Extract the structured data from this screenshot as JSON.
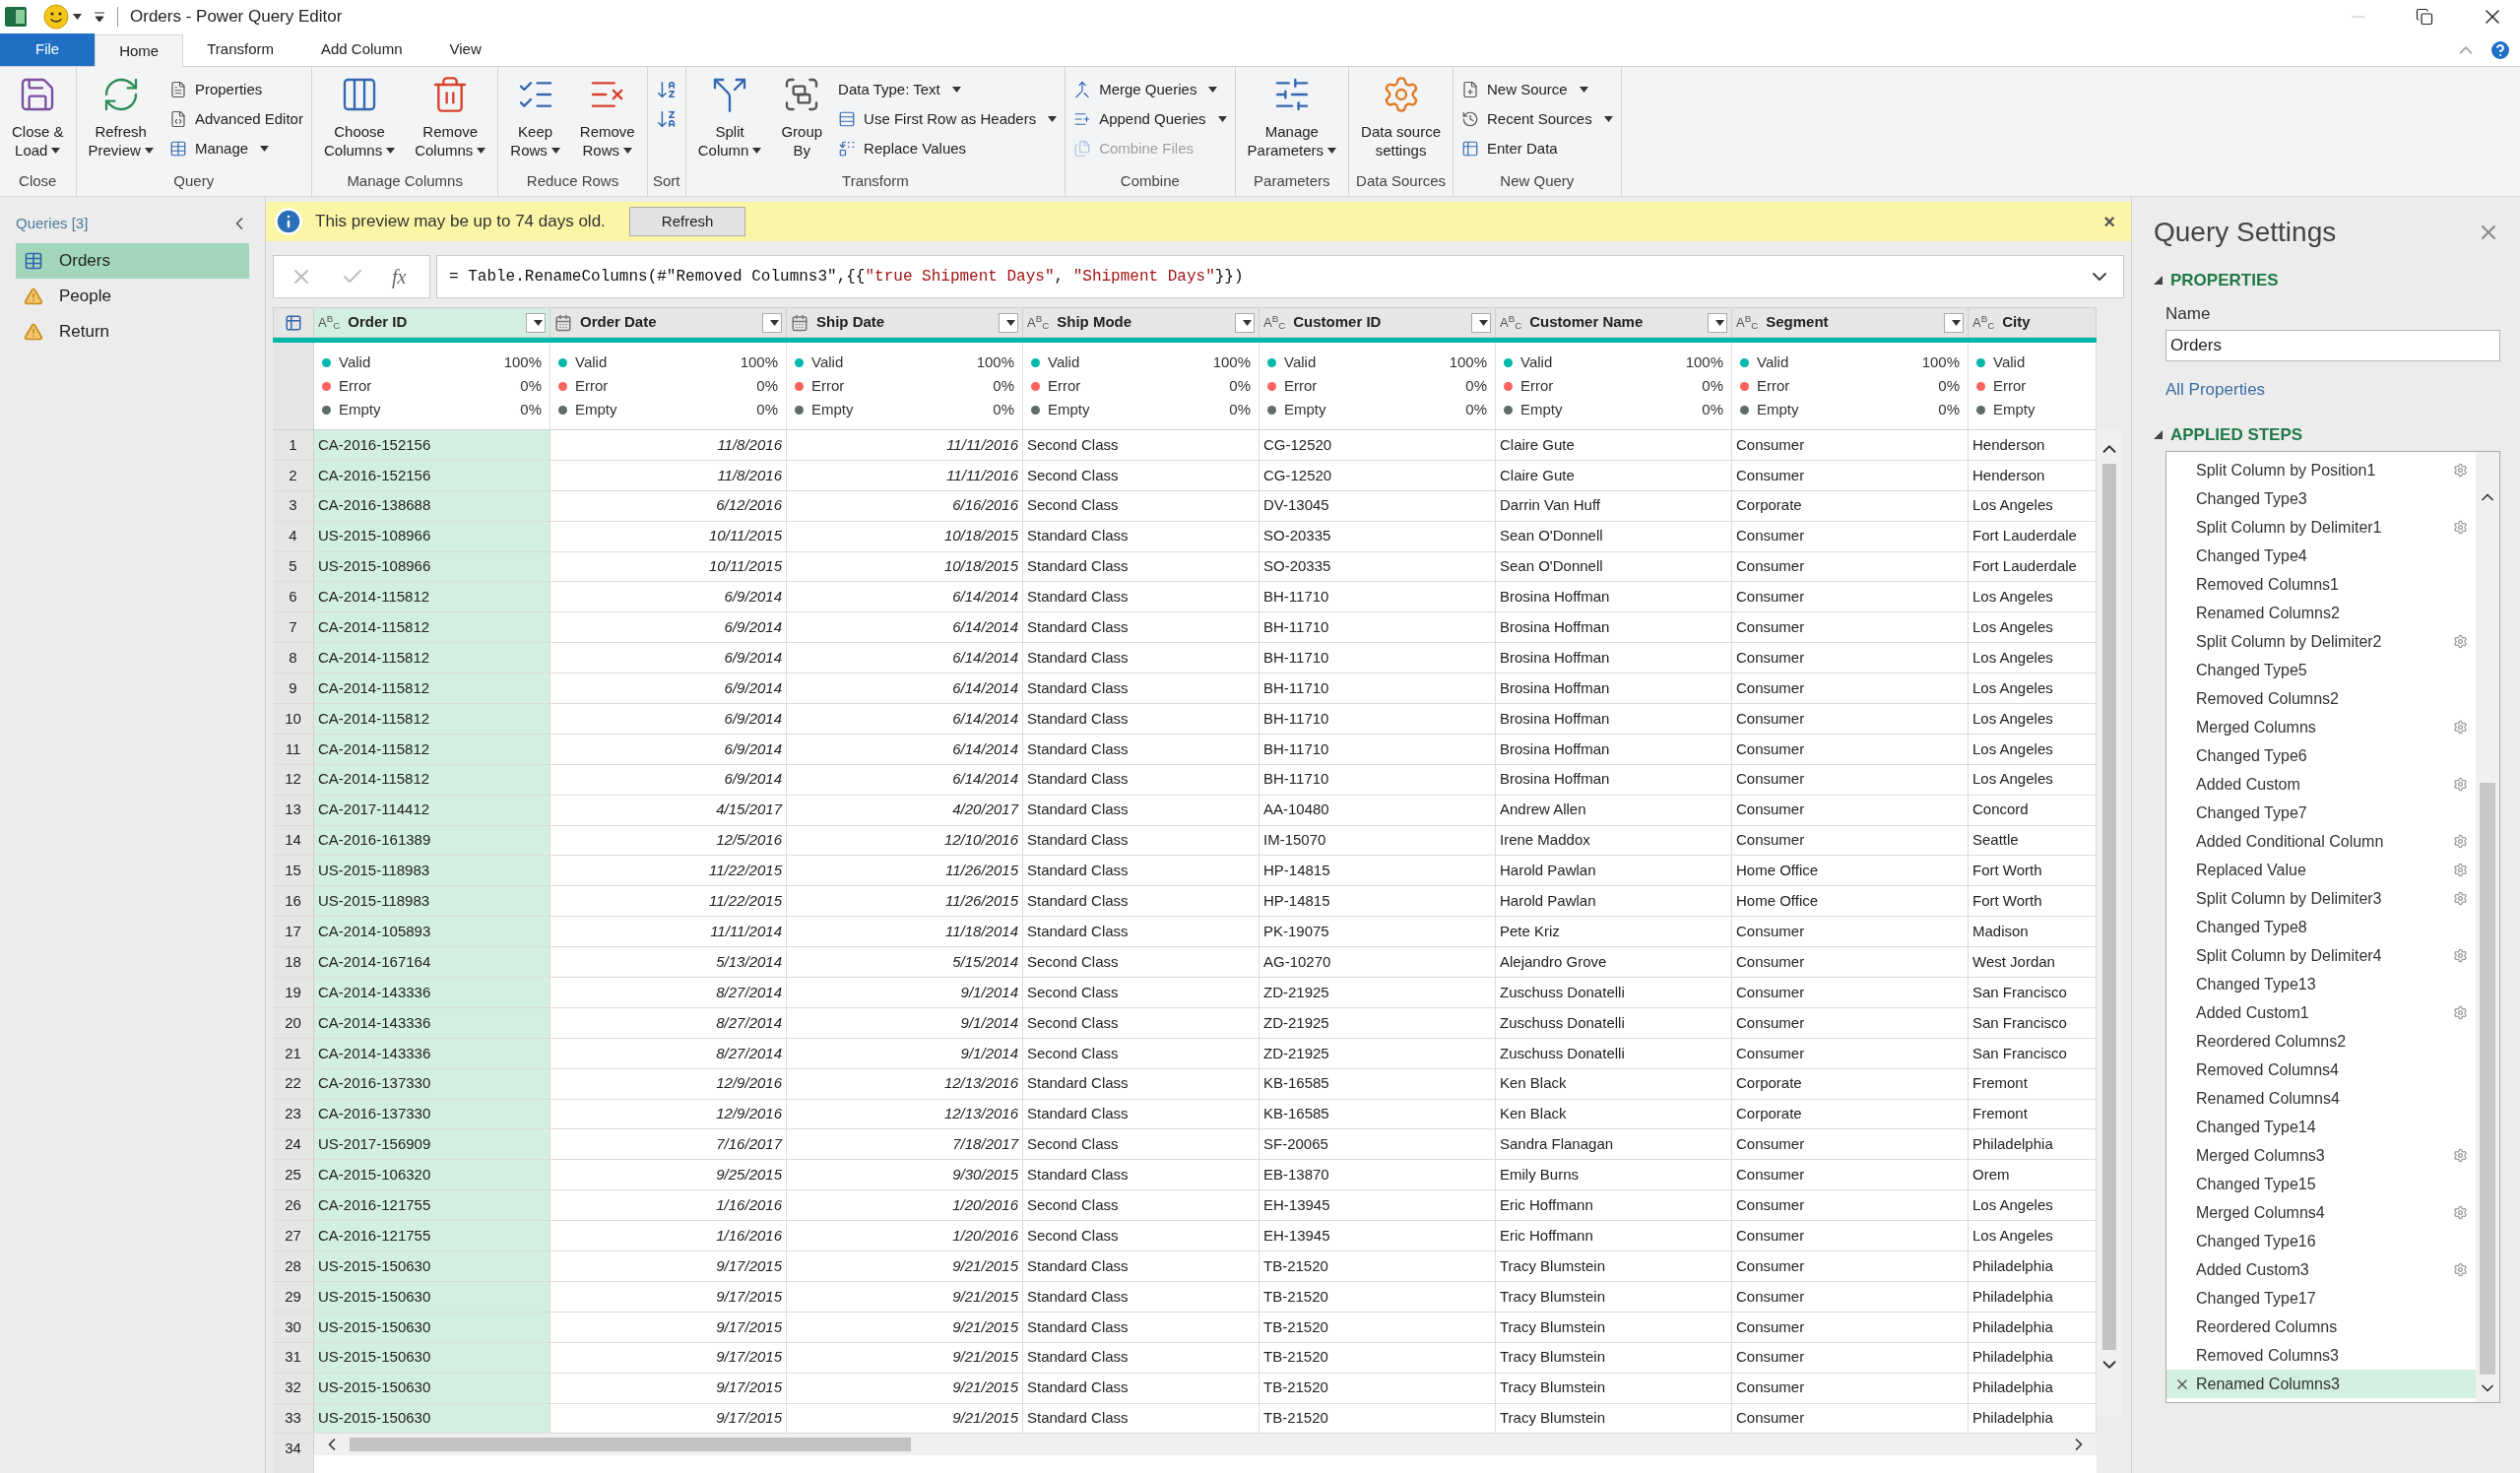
{
  "window": {
    "title": "Orders - Power Query Editor"
  },
  "ribbon_tabs": [
    {
      "label": "File",
      "kind": "file",
      "selected": false
    },
    {
      "label": "Home",
      "kind": "tab",
      "selected": true
    },
    {
      "label": "Transform",
      "kind": "tab",
      "selected": false
    },
    {
      "label": "Add Column",
      "kind": "tab",
      "selected": false
    },
    {
      "label": "View",
      "kind": "tab",
      "selected": false
    }
  ],
  "ribbon_groups": [
    {
      "label": "Close",
      "buttons": [
        {
          "kind": "large",
          "lines": [
            "Close &",
            "Load"
          ],
          "dropdown": true,
          "disabled": false
        }
      ]
    },
    {
      "label": "Query",
      "buttons": [
        {
          "kind": "large",
          "lines": [
            "Refresh",
            "Preview"
          ],
          "dropdown": true,
          "disabled": false
        },
        {
          "kind": "small",
          "lines": [
            "Properties"
          ],
          "dropdown": false,
          "disabled": false
        },
        {
          "kind": "small",
          "lines": [
            "Advanced Editor"
          ],
          "dropdown": false,
          "disabled": false
        },
        {
          "kind": "small",
          "lines": [
            "Manage"
          ],
          "dropdown": true,
          "disabled": false
        }
      ]
    },
    {
      "label": "Manage Columns",
      "buttons": [
        {
          "kind": "large",
          "lines": [
            "Choose",
            "Columns"
          ],
          "dropdown": true,
          "disabled": false
        },
        {
          "kind": "large",
          "lines": [
            "Remove",
            "Columns"
          ],
          "dropdown": true,
          "disabled": false
        }
      ]
    },
    {
      "label": "Reduce Rows",
      "buttons": [
        {
          "kind": "large",
          "lines": [
            "Keep",
            "Rows"
          ],
          "dropdown": true,
          "disabled": false
        },
        {
          "kind": "large",
          "lines": [
            "Remove",
            "Rows"
          ],
          "dropdown": true,
          "disabled": false
        }
      ]
    },
    {
      "label": "Sort",
      "buttons": [
        {
          "kind": "icon"
        },
        {
          "kind": "icon"
        }
      ]
    },
    {
      "label": "Transform",
      "buttons": [
        {
          "kind": "large",
          "lines": [
            "Split",
            "Column"
          ],
          "dropdown": true,
          "disabled": false
        },
        {
          "kind": "large",
          "lines": [
            "Group",
            "By"
          ],
          "dropdown": false,
          "disabled": false
        },
        {
          "kind": "small",
          "lines": [
            "Data Type: Text"
          ],
          "dropdown": true,
          "disabled": false
        },
        {
          "kind": "small",
          "lines": [
            "Use First Row as Headers"
          ],
          "dropdown": true,
          "disabled": false
        },
        {
          "kind": "small",
          "lines": [
            "Replace Values"
          ],
          "dropdown": false,
          "disabled": false
        }
      ]
    },
    {
      "label": "Combine",
      "buttons": [
        {
          "kind": "small",
          "lines": [
            "Merge Queries"
          ],
          "dropdown": true,
          "disabled": false
        },
        {
          "kind": "small",
          "lines": [
            "Append Queries"
          ],
          "dropdown": true,
          "disabled": false
        },
        {
          "kind": "small",
          "lines": [
            "Combine Files"
          ],
          "dropdown": false,
          "disabled": true
        }
      ]
    },
    {
      "label": "Parameters",
      "buttons": [
        {
          "kind": "large",
          "lines": [
            "Manage",
            "Parameters"
          ],
          "dropdown": true,
          "disabled": false
        }
      ]
    },
    {
      "label": "Data Sources",
      "buttons": [
        {
          "kind": "large",
          "lines": [
            "Data source",
            "settings"
          ],
          "dropdown": false,
          "disabled": false
        }
      ]
    },
    {
      "label": "New Query",
      "buttons": [
        {
          "kind": "small",
          "lines": [
            "New Source"
          ],
          "dropdown": true,
          "disabled": false
        },
        {
          "kind": "small",
          "lines": [
            "Recent Sources"
          ],
          "dropdown": true,
          "disabled": false
        },
        {
          "kind": "small",
          "lines": [
            "Enter Data"
          ],
          "dropdown": false,
          "disabled": false
        }
      ]
    }
  ],
  "queries": {
    "header": "Queries [3]",
    "items": [
      {
        "name": "Orders",
        "kind": "table",
        "selected": true
      },
      {
        "name": "People",
        "kind": "warning",
        "selected": false
      },
      {
        "name": "Return",
        "kind": "warning",
        "selected": false
      }
    ]
  },
  "info_bar": {
    "message": "This preview may be up to 74 days old.",
    "button": "Refresh",
    "close": "×"
  },
  "formula_bar": {
    "fx": "fx",
    "segments": [
      {
        "text": "= Table.RenameColumns(#\"Removed Columns3\",{{",
        "kind": "code"
      },
      {
        "text": "\"true Shipment Days\"",
        "kind": "string"
      },
      {
        "text": ", ",
        "kind": "code"
      },
      {
        "text": "\"Shipment Days\"",
        "kind": "string"
      },
      {
        "text": "}})",
        "kind": "code"
      }
    ]
  },
  "table": {
    "columns": [
      {
        "name": "Order ID",
        "kind": "text",
        "type_label": "A$^{B}$$_{C}$",
        "selected": true
      },
      {
        "name": "Order Date",
        "kind": "date",
        "selected": false
      },
      {
        "name": "Ship Date",
        "kind": "date",
        "selected": false
      },
      {
        "name": "Ship Mode",
        "kind": "text",
        "type_label": "A$^{B}$$_{C}$",
        "selected": false
      },
      {
        "name": "Customer ID",
        "kind": "text",
        "type_label": "A$^{B}$$_{C}$",
        "selected": false
      },
      {
        "name": "Customer Name",
        "kind": "text",
        "type_label": "A$^{B}$$_{C}$",
        "selected": false
      },
      {
        "name": "Segment",
        "kind": "text",
        "type_label": "A$^{B}$$_{C}$",
        "selected": false
      },
      {
        "name": "City",
        "kind": "text",
        "type_label": "A$^{B}$$_{C}$",
        "selected": false,
        "narrow": true
      }
    ],
    "quality": [
      [
        {
          "label": "Valid",
          "value": "100%",
          "color": "#01b8aa"
        },
        {
          "label": "Error",
          "value": "0%",
          "color": "#fd625e"
        },
        {
          "label": "Empty",
          "value": "0%",
          "color": "#5f6b6d"
        }
      ],
      [
        {
          "label": "Valid",
          "value": "100%",
          "color": "#01b8aa"
        },
        {
          "label": "Error",
          "value": "0%",
          "color": "#fd625e"
        },
        {
          "label": "Empty",
          "value": "0%",
          "color": "#5f6b6d"
        }
      ],
      [
        {
          "label": "Valid",
          "value": "100%",
          "color": "#01b8aa"
        },
        {
          "label": "Error",
          "value": "0%",
          "color": "#fd625e"
        },
        {
          "label": "Empty",
          "value": "0%",
          "color": "#5f6b6d"
        }
      ],
      [
        {
          "label": "Valid",
          "value": "100%",
          "color": "#01b8aa"
        },
        {
          "label": "Error",
          "value": "0%",
          "color": "#fd625e"
        },
        {
          "label": "Empty",
          "value": "0%",
          "color": "#5f6b6d"
        }
      ],
      [
        {
          "label": "Valid",
          "value": "100%",
          "color": "#01b8aa"
        },
        {
          "label": "Error",
          "value": "0%",
          "color": "#fd625e"
        },
        {
          "label": "Empty",
          "value": "0%",
          "color": "#5f6b6d"
        }
      ],
      [
        {
          "label": "Valid",
          "value": "100%",
          "color": "#01b8aa"
        },
        {
          "label": "Error",
          "value": "0%",
          "color": "#fd625e"
        },
        {
          "label": "Empty",
          "value": "0%",
          "color": "#5f6b6d"
        }
      ],
      [
        {
          "label": "Valid",
          "value": "100%",
          "color": "#01b8aa"
        },
        {
          "label": "Error",
          "value": "0%",
          "color": "#fd625e"
        },
        {
          "label": "Empty",
          "value": "0%",
          "color": "#5f6b6d"
        }
      ],
      [
        {
          "label": "Valid",
          "color": "#01b8aa"
        },
        {
          "label": "Error",
          "color": "#fd625e"
        },
        {
          "label": "Empty",
          "color": "#5f6b6d"
        }
      ]
    ],
    "rows": [
      {
        "n": "1",
        "cells": [
          "CA-2016-152156",
          "11/8/2016",
          "11/11/2016",
          "Second Class",
          "CG-12520",
          "Claire Gute",
          "Consumer",
          "Henderson"
        ]
      },
      {
        "n": "2",
        "cells": [
          "CA-2016-152156",
          "11/8/2016",
          "11/11/2016",
          "Second Class",
          "CG-12520",
          "Claire Gute",
          "Consumer",
          "Henderson"
        ]
      },
      {
        "n": "3",
        "cells": [
          "CA-2016-138688",
          "6/12/2016",
          "6/16/2016",
          "Second Class",
          "DV-13045",
          "Darrin Van Huff",
          "Corporate",
          "Los Angeles"
        ]
      },
      {
        "n": "4",
        "cells": [
          "US-2015-108966",
          "10/11/2015",
          "10/18/2015",
          "Standard Class",
          "SO-20335",
          "Sean O'Donnell",
          "Consumer",
          "Fort Lauderdale"
        ]
      },
      {
        "n": "5",
        "cells": [
          "US-2015-108966",
          "10/11/2015",
          "10/18/2015",
          "Standard Class",
          "SO-20335",
          "Sean O'Donnell",
          "Consumer",
          "Fort Lauderdale"
        ]
      },
      {
        "n": "6",
        "cells": [
          "CA-2014-115812",
          "6/9/2014",
          "6/14/2014",
          "Standard Class",
          "BH-11710",
          "Brosina Hoffman",
          "Consumer",
          "Los Angeles"
        ]
      },
      {
        "n": "7",
        "cells": [
          "CA-2014-115812",
          "6/9/2014",
          "6/14/2014",
          "Standard Class",
          "BH-11710",
          "Brosina Hoffman",
          "Consumer",
          "Los Angeles"
        ]
      },
      {
        "n": "8",
        "cells": [
          "CA-2014-115812",
          "6/9/2014",
          "6/14/2014",
          "Standard Class",
          "BH-11710",
          "Brosina Hoffman",
          "Consumer",
          "Los Angeles"
        ]
      },
      {
        "n": "9",
        "cells": [
          "CA-2014-115812",
          "6/9/2014",
          "6/14/2014",
          "Standard Class",
          "BH-11710",
          "Brosina Hoffman",
          "Consumer",
          "Los Angeles"
        ]
      },
      {
        "n": "10",
        "cells": [
          "CA-2014-115812",
          "6/9/2014",
          "6/14/2014",
          "Standard Class",
          "BH-11710",
          "Brosina Hoffman",
          "Consumer",
          "Los Angeles"
        ]
      },
      {
        "n": "11",
        "cells": [
          "CA-2014-115812",
          "6/9/2014",
          "6/14/2014",
          "Standard Class",
          "BH-11710",
          "Brosina Hoffman",
          "Consumer",
          "Los Angeles"
        ]
      },
      {
        "n": "12",
        "cells": [
          "CA-2014-115812",
          "6/9/2014",
          "6/14/2014",
          "Standard Class",
          "BH-11710",
          "Brosina Hoffman",
          "Consumer",
          "Los Angeles"
        ]
      },
      {
        "n": "13",
        "cells": [
          "CA-2017-114412",
          "4/15/2017",
          "4/20/2017",
          "Standard Class",
          "AA-10480",
          "Andrew Allen",
          "Consumer",
          "Concord"
        ]
      },
      {
        "n": "14",
        "cells": [
          "CA-2016-161389",
          "12/5/2016",
          "12/10/2016",
          "Standard Class",
          "IM-15070",
          "Irene Maddox",
          "Consumer",
          "Seattle"
        ]
      },
      {
        "n": "15",
        "cells": [
          "US-2015-118983",
          "11/22/2015",
          "11/26/2015",
          "Standard Class",
          "HP-14815",
          "Harold Pawlan",
          "Home Office",
          "Fort Worth"
        ]
      },
      {
        "n": "16",
        "cells": [
          "US-2015-118983",
          "11/22/2015",
          "11/26/2015",
          "Standard Class",
          "HP-14815",
          "Harold Pawlan",
          "Home Office",
          "Fort Worth"
        ]
      },
      {
        "n": "17",
        "cells": [
          "CA-2014-105893",
          "11/11/2014",
          "11/18/2014",
          "Standard Class",
          "PK-19075",
          "Pete Kriz",
          "Consumer",
          "Madison"
        ]
      },
      {
        "n": "18",
        "cells": [
          "CA-2014-167164",
          "5/13/2014",
          "5/15/2014",
          "Second Class",
          "AG-10270",
          "Alejandro Grove",
          "Consumer",
          "West Jordan"
        ]
      },
      {
        "n": "19",
        "cells": [
          "CA-2014-143336",
          "8/27/2014",
          "9/1/2014",
          "Second Class",
          "ZD-21925",
          "Zuschuss Donatelli",
          "Consumer",
          "San Francisco"
        ]
      },
      {
        "n": "20",
        "cells": [
          "CA-2014-143336",
          "8/27/2014",
          "9/1/2014",
          "Second Class",
          "ZD-21925",
          "Zuschuss Donatelli",
          "Consumer",
          "San Francisco"
        ]
      },
      {
        "n": "21",
        "cells": [
          "CA-2014-143336",
          "8/27/2014",
          "9/1/2014",
          "Second Class",
          "ZD-21925",
          "Zuschuss Donatelli",
          "Consumer",
          "San Francisco"
        ]
      },
      {
        "n": "22",
        "cells": [
          "CA-2016-137330",
          "12/9/2016",
          "12/13/2016",
          "Standard Class",
          "KB-16585",
          "Ken Black",
          "Corporate",
          "Fremont"
        ]
      },
      {
        "n": "23",
        "cells": [
          "CA-2016-137330",
          "12/9/2016",
          "12/13/2016",
          "Standard Class",
          "KB-16585",
          "Ken Black",
          "Corporate",
          "Fremont"
        ]
      },
      {
        "n": "24",
        "cells": [
          "US-2017-156909",
          "7/16/2017",
          "7/18/2017",
          "Second Class",
          "SF-20065",
          "Sandra Flanagan",
          "Consumer",
          "Philadelphia"
        ]
      },
      {
        "n": "25",
        "cells": [
          "CA-2015-106320",
          "9/25/2015",
          "9/30/2015",
          "Standard Class",
          "EB-13870",
          "Emily Burns",
          "Consumer",
          "Orem"
        ]
      },
      {
        "n": "26",
        "cells": [
          "CA-2016-121755",
          "1/16/2016",
          "1/20/2016",
          "Second Class",
          "EH-13945",
          "Eric Hoffmann",
          "Consumer",
          "Los Angeles"
        ]
      },
      {
        "n": "27",
        "cells": [
          "CA-2016-121755",
          "1/16/2016",
          "1/20/2016",
          "Second Class",
          "EH-13945",
          "Eric Hoffmann",
          "Consumer",
          "Los Angeles"
        ]
      },
      {
        "n": "28",
        "cells": [
          "US-2015-150630",
          "9/17/2015",
          "9/21/2015",
          "Standard Class",
          "TB-21520",
          "Tracy Blumstein",
          "Consumer",
          "Philadelphia"
        ]
      },
      {
        "n": "29",
        "cells": [
          "US-2015-150630",
          "9/17/2015",
          "9/21/2015",
          "Standard Class",
          "TB-21520",
          "Tracy Blumstein",
          "Consumer",
          "Philadelphia"
        ]
      },
      {
        "n": "30",
        "cells": [
          "US-2015-150630",
          "9/17/2015",
          "9/21/2015",
          "Standard Class",
          "TB-21520",
          "Tracy Blumstein",
          "Consumer",
          "Philadelphia"
        ]
      },
      {
        "n": "31",
        "cells": [
          "US-2015-150630",
          "9/17/2015",
          "9/21/2015",
          "Standard Class",
          "TB-21520",
          "Tracy Blumstein",
          "Consumer",
          "Philadelphia"
        ]
      },
      {
        "n": "32",
        "cells": [
          "US-2015-150630",
          "9/17/2015",
          "9/21/2015",
          "Standard Class",
          "TB-21520",
          "Tracy Blumstein",
          "Consumer",
          "Philadelphia"
        ]
      },
      {
        "n": "33",
        "cells": [
          "US-2015-150630",
          "9/17/2015",
          "9/21/2015",
          "Standard Class",
          "TB-21520",
          "Tracy Blumstein",
          "Consumer",
          "Philadelphia"
        ]
      }
    ],
    "partial_row_number": "34"
  },
  "query_settings": {
    "title": "Query Settings",
    "properties_heading": "PROPERTIES",
    "name_label": "Name",
    "name_value": "Orders",
    "all_properties": "All Properties",
    "steps_heading": "APPLIED STEPS",
    "steps": [
      {
        "label": "Split Column by Position1",
        "gear": true,
        "selected": false
      },
      {
        "label": "Changed Type3",
        "gear": false,
        "selected": false
      },
      {
        "label": "Split Column by Delimiter1",
        "gear": true,
        "selected": false
      },
      {
        "label": "Changed Type4",
        "gear": false,
        "selected": false
      },
      {
        "label": "Removed Columns1",
        "gear": false,
        "selected": false
      },
      {
        "label": "Renamed Columns2",
        "gear": false,
        "selected": false
      },
      {
        "label": "Split Column by Delimiter2",
        "gear": true,
        "selected": false
      },
      {
        "label": "Changed Type5",
        "gear": false,
        "selected": false
      },
      {
        "label": "Removed Columns2",
        "gear": false,
        "selected": false
      },
      {
        "label": "Merged Columns",
        "gear": true,
        "selected": false
      },
      {
        "label": "Changed Type6",
        "gear": false,
        "selected": false
      },
      {
        "label": "Added Custom",
        "gear": true,
        "selected": false
      },
      {
        "label": "Changed Type7",
        "gear": false,
        "selected": false
      },
      {
        "label": "Added Conditional Column",
        "gear": true,
        "selected": false
      },
      {
        "label": "Replaced Value",
        "gear": true,
        "selected": false
      },
      {
        "label": "Split Column by Delimiter3",
        "gear": true,
        "selected": false
      },
      {
        "label": "Changed Type8",
        "gear": false,
        "selected": false
      },
      {
        "label": "Split Column by Delimiter4",
        "gear": true,
        "selected": false
      },
      {
        "label": "Changed Type13",
        "gear": false,
        "selected": false
      },
      {
        "label": "Added Custom1",
        "gear": true,
        "selected": false
      },
      {
        "label": "Reordered Columns2",
        "gear": false,
        "selected": false
      },
      {
        "label": "Removed Columns4",
        "gear": false,
        "selected": false
      },
      {
        "label": "Renamed Columns4",
        "gear": false,
        "selected": false
      },
      {
        "label": "Changed Type14",
        "gear": false,
        "selected": false
      },
      {
        "label": "Merged Columns3",
        "gear": true,
        "selected": false
      },
      {
        "label": "Changed Type15",
        "gear": false,
        "selected": false
      },
      {
        "label": "Merged Columns4",
        "gear": true,
        "selected": false
      },
      {
        "label": "Changed Type16",
        "gear": false,
        "selected": false
      },
      {
        "label": "Added Custom3",
        "gear": true,
        "selected": false
      },
      {
        "label": "Changed Type17",
        "gear": false,
        "selected": false
      },
      {
        "label": "Reordered Columns",
        "gear": false,
        "selected": false
      },
      {
        "label": "Removed Columns3",
        "gear": false,
        "selected": false
      },
      {
        "label": "Renamed Columns3",
        "gear": false,
        "selected": true
      }
    ]
  }
}
